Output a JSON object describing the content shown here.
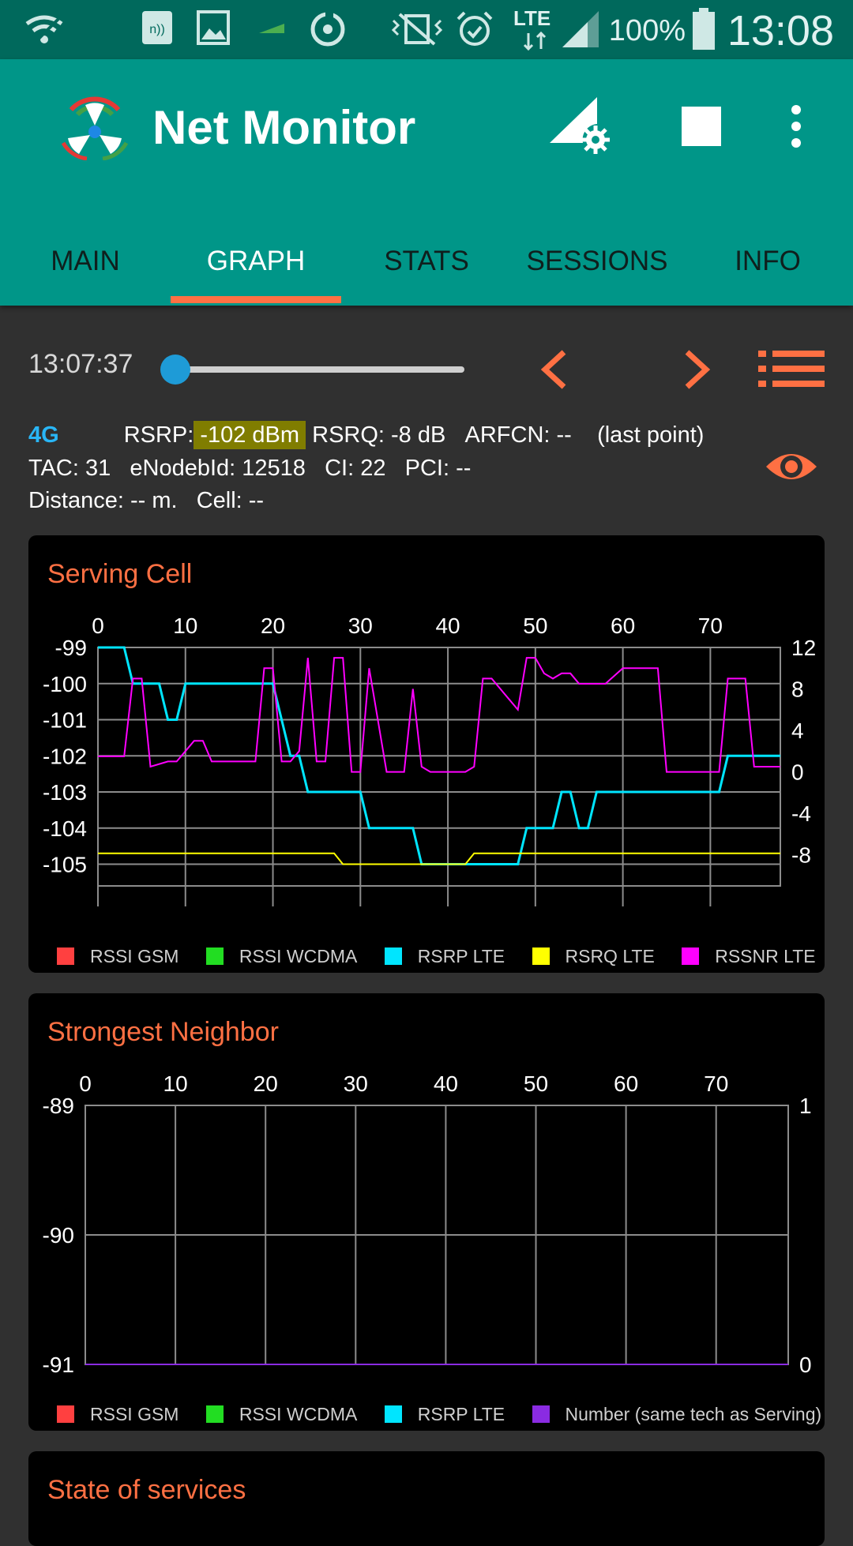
{
  "status_bar": {
    "lte_label": "LTE",
    "battery": "100%",
    "time": "13:08"
  },
  "app": {
    "title": "Net Monitor"
  },
  "tabs": [
    {
      "label": "MAIN"
    },
    {
      "label": "GRAPH"
    },
    {
      "label": "STATS"
    },
    {
      "label": "SESSIONS"
    },
    {
      "label": "INFO"
    }
  ],
  "controls": {
    "time": "13:07:37",
    "slider_position": 0
  },
  "cell_info": {
    "tech": "4G",
    "rsrp_label": "RSRP:",
    "rsrp_value": "-102 dBm",
    "rsrq": "RSRQ: -8 dB",
    "arfcn": "ARFCN: --",
    "note": "(last point)",
    "tac": "TAC: 31",
    "enodeb": "eNodebId: 12518",
    "ci": "CI: 22",
    "pci": "PCI: --",
    "distance": "Distance: -- m.",
    "cell": "Cell: --"
  },
  "serving_cell": {
    "title": "Serving Cell",
    "legend": [
      {
        "label": "RSSI GSM",
        "color": "#ff4040"
      },
      {
        "label": "RSSI WCDMA",
        "color": "#22dd22"
      },
      {
        "label": "RSRP LTE",
        "color": "#00e5ff"
      },
      {
        "label": "RSRQ LTE",
        "color": "#ffff00"
      },
      {
        "label": "RSSNR LTE",
        "color": "#ff00ff"
      }
    ]
  },
  "strongest_neighbor": {
    "title": "Strongest Neighbor",
    "legend": [
      {
        "label": "RSSI GSM",
        "color": "#ff4040"
      },
      {
        "label": "RSSI WCDMA",
        "color": "#22dd22"
      },
      {
        "label": "RSRP LTE",
        "color": "#00e5ff"
      },
      {
        "label": "Number (same tech as Serving)",
        "color": "#8a2be2"
      }
    ]
  },
  "state_of_services": {
    "title": "State of services"
  },
  "chart_data": [
    {
      "type": "line",
      "title": "Serving Cell",
      "x_ticks": [
        0,
        10,
        20,
        30,
        40,
        50,
        60,
        70
      ],
      "xlim": [
        0,
        78
      ],
      "ylim_left": [
        -105.6,
        -99
      ],
      "ylim_right": [
        -11,
        12
      ],
      "y_ticks_left": [
        -99,
        -100,
        -101,
        -102,
        -103,
        -104,
        -105
      ],
      "y_ticks_right": [
        12,
        8,
        4,
        0,
        -4,
        -8
      ],
      "grid": true,
      "series": [
        {
          "name": "RSRP LTE",
          "axis": "left",
          "color": "#00e5ff",
          "x": [
            0,
            3,
            4,
            7,
            8,
            9,
            10,
            20,
            22,
            23,
            24,
            30,
            31,
            36,
            37,
            42,
            43,
            48,
            49,
            52,
            53,
            54,
            55,
            56,
            57,
            58,
            59,
            71,
            72,
            78
          ],
          "y": [
            -99,
            -99,
            -100,
            -100,
            -101,
            -101,
            -100,
            -100,
            -102,
            -102,
            -103,
            -103,
            -104,
            -104,
            -105,
            -105,
            -105,
            -105,
            -104,
            -104,
            -103,
            -103,
            -104,
            -104,
            -103,
            -103,
            -103,
            -103,
            -102,
            -102
          ]
        },
        {
          "name": "RSRQ LTE",
          "axis": "left",
          "color": "#ffff00",
          "x": [
            0,
            27,
            28,
            42,
            43,
            78
          ],
          "y": [
            -104.7,
            -104.7,
            -105,
            -105,
            -104.7,
            -104.7
          ]
        },
        {
          "name": "RSSNR LTE",
          "axis": "right",
          "color": "#ff00ff",
          "x": [
            0,
            3,
            4,
            5,
            6,
            8,
            9,
            10,
            11,
            12,
            13,
            18,
            19,
            20,
            21,
            22,
            23,
            24,
            25,
            26,
            27,
            28,
            29,
            30,
            31,
            33,
            34,
            35,
            36,
            37,
            38,
            41,
            42,
            43,
            44,
            45,
            47,
            48,
            49,
            50,
            51,
            52,
            53,
            54,
            55,
            57,
            58,
            60,
            61,
            64,
            65,
            70,
            71,
            72,
            74,
            75,
            78
          ],
          "y": [
            1.5,
            1.5,
            9,
            9,
            0.5,
            1,
            1,
            2,
            3,
            3,
            1,
            1,
            10,
            10,
            1,
            1,
            2,
            11,
            1,
            1,
            11,
            11,
            0,
            0,
            10,
            0,
            0,
            0,
            8,
            0.5,
            0,
            0,
            0,
            0.5,
            9,
            9,
            7,
            6,
            11,
            11,
            9.5,
            9,
            9.5,
            9.5,
            8.5,
            8.5,
            8.5,
            10,
            10,
            10,
            0,
            0,
            0,
            9,
            9,
            0.5,
            0.5
          ]
        }
      ]
    },
    {
      "type": "line",
      "title": "Strongest Neighbor",
      "x_ticks": [
        0,
        10,
        20,
        30,
        40,
        50,
        60,
        70
      ],
      "xlim": [
        0,
        78
      ],
      "ylim_left": [
        -91,
        -89
      ],
      "ylim_right": [
        0,
        1
      ],
      "y_ticks_left": [
        -89,
        -90,
        -91
      ],
      "y_ticks_right": [
        1,
        0
      ],
      "grid": true,
      "series": [
        {
          "name": "Number (same tech as Serving)",
          "axis": "right",
          "color": "#8a2be2",
          "x": [
            0,
            78
          ],
          "y": [
            0,
            0
          ]
        }
      ]
    }
  ]
}
